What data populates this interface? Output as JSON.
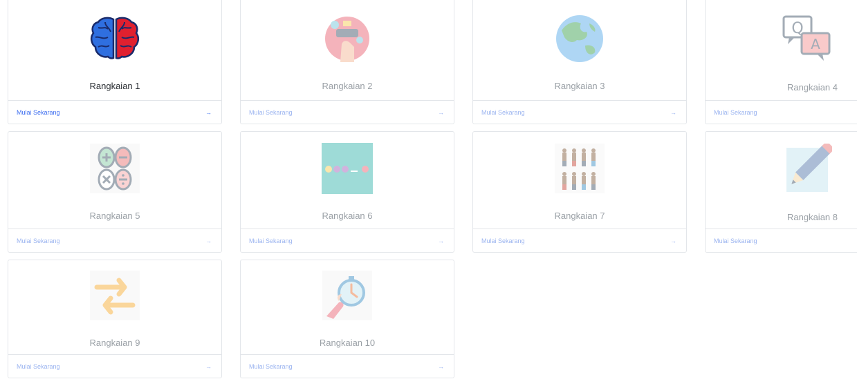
{
  "cards": [
    {
      "title": "Rangkaian 1",
      "cta": "Mulai Sekarang",
      "arrow": "→",
      "icon": "brain-icon"
    },
    {
      "title": "Rangkaian 2",
      "cta": "Mulai Sekarang",
      "arrow": "→",
      "icon": "technology-hand-icon"
    },
    {
      "title": "Rangkaian 3",
      "cta": "Mulai Sekarang",
      "arrow": "→",
      "icon": "globe-icon"
    },
    {
      "title": "Rangkaian 4",
      "cta": "Mulai Sekarang",
      "arrow": "→",
      "icon": "question-answer-icon"
    },
    {
      "title": "Rangkaian 5",
      "cta": "Mulai Sekarang",
      "arrow": "→",
      "icon": "math-operators-icon"
    },
    {
      "title": "Rangkaian 6",
      "cta": "Mulai Sekarang",
      "arrow": "→",
      "icon": "number-sequence-icon"
    },
    {
      "title": "Rangkaian 7",
      "cta": "Mulai Sekarang",
      "arrow": "→",
      "icon": "people-group-icon"
    },
    {
      "title": "Rangkaian 8",
      "cta": "Mulai Sekarang",
      "arrow": "→",
      "icon": "pencil-icon"
    },
    {
      "title": "Rangkaian 9",
      "cta": "Mulai Sekarang",
      "arrow": "→",
      "icon": "swap-arrows-icon"
    },
    {
      "title": "Rangkaian 10",
      "cta": "Mulai Sekarang",
      "arrow": "→",
      "icon": "stopwatch-icon"
    }
  ],
  "colors": {
    "link_active": "#3c6df0",
    "link_faded": "#9bb4f0",
    "text_active": "#2a2e33",
    "text_faded": "#9aa0a6"
  }
}
